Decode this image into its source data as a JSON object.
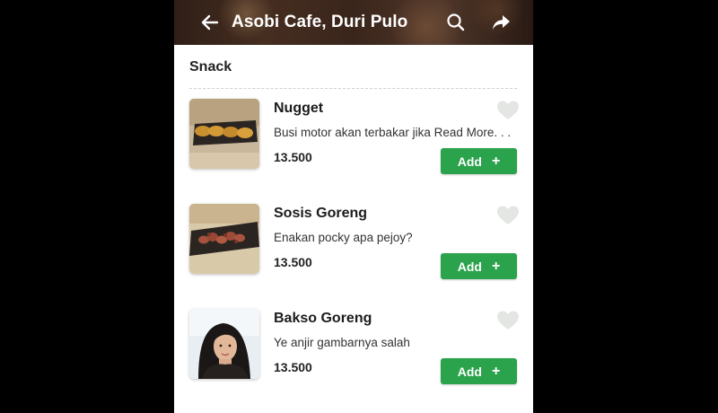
{
  "header": {
    "title": "Asobi Cafe, Duri Pulo",
    "back_icon": "arrow-left-icon",
    "search_icon": "search-icon",
    "share_icon": "share-icon"
  },
  "section": {
    "title": "Snack"
  },
  "items": [
    {
      "name": "Nugget",
      "description": "Busi motor akan terbakar jika Read More. . .",
      "price": "13.500",
      "add_label": "Add",
      "add_icon": "+",
      "image": "nugget-photo"
    },
    {
      "name": "Sosis Goreng",
      "description": "Enakan pocky apa pejoy?",
      "price": "13.500",
      "add_label": "Add",
      "add_icon": "+",
      "image": "sausage-photo"
    },
    {
      "name": "Bakso Goreng",
      "description": "Ye anjir gambarnya salah",
      "price": "13.500",
      "add_label": "Add",
      "add_icon": "+",
      "image": "person-photo"
    }
  ],
  "colors": {
    "add_button": "#2ba24c",
    "favorite_icon": "#e3e6e3"
  }
}
